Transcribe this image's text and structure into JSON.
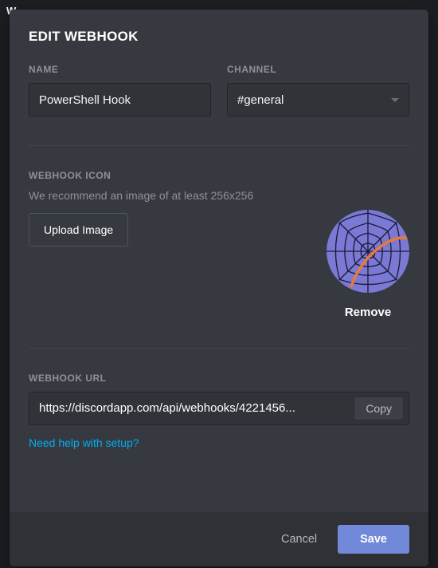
{
  "modal": {
    "title": "EDIT WEBHOOK",
    "name_label": "NAME",
    "name_value": "PowerShell Hook",
    "channel_label": "CHANNEL",
    "channel_value": "#general",
    "icon_label": "WEBHOOK ICON",
    "icon_hint": "We recommend an image of at least 256x256",
    "upload_label": "Upload Image",
    "remove_label": "Remove",
    "url_label": "WEBHOOK URL",
    "url_value": "https://discordapp.com/api/webhooks/4221456...",
    "copy_label": "Copy",
    "help_label": "Need help with setup?",
    "cancel_label": "Cancel",
    "save_label": "Save"
  },
  "icon": {
    "name": "spiderweb-icon"
  },
  "colors": {
    "accent": "#7289da",
    "link": "#00aff4",
    "avatar_bg": "#7a79d4"
  },
  "backdrop_letter": "W"
}
